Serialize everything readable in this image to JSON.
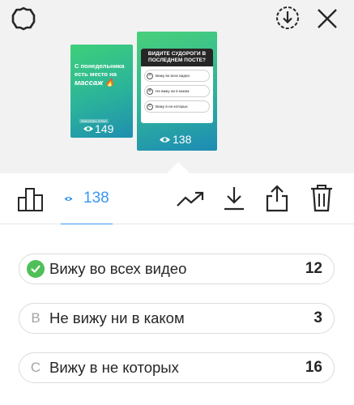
{
  "header": {
    "settings_icon": "gear-icon",
    "download_icon": "download-circle-icon",
    "close_icon": "close-icon"
  },
  "stories": [
    {
      "text_line1": "С понедельника",
      "text_line2": "есть место на",
      "text_line3": "массаж 🔥",
      "tag": "RAKOSEL STAS",
      "views": "149"
    },
    {
      "question": "ВИДИТЕ СУДОРОГИ В ПОСЛЕДНЕМ ПОСТЕ?",
      "options": [
        {
          "letter": "A",
          "text": "Вижу во всех видео"
        },
        {
          "letter": "B",
          "text": "Не вижу ни в каком"
        },
        {
          "letter": "C",
          "text": "Вижу в не которых"
        }
      ],
      "views": "138"
    }
  ],
  "toolbar": {
    "viewers_count": "138",
    "icons": [
      "bar-chart-icon",
      "eye-icon",
      "trending-icon",
      "save-icon",
      "share-icon",
      "trash-icon"
    ]
  },
  "poll_results": [
    {
      "marker": "check",
      "letter": "",
      "label": "Вижу во всех видео",
      "count": "12"
    },
    {
      "marker": "letter",
      "letter": "B",
      "label": "Не вижу ни в каком",
      "count": "3"
    },
    {
      "marker": "letter",
      "letter": "C",
      "label": "Вижу в не которых",
      "count": "16"
    }
  ],
  "colors": {
    "accent": "#3897f0",
    "check": "#4fbf58",
    "top_background": "#f2f2f2",
    "text": "#262626"
  }
}
